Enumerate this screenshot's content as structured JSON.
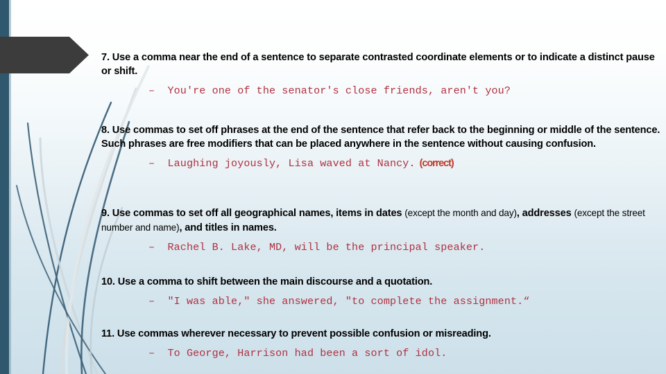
{
  "slide": {
    "background_top_color": "#ffffff",
    "background_bottom_color": "#cde0ea",
    "accent_bar_color": "#2f576e",
    "banner_color": "#3c3c3c",
    "example_text_color": "#b03040",
    "annotation_color": "#c0392b"
  },
  "rules": [
    {
      "id": "rule-7",
      "text": "7. Use a comma near the end of a sentence to separate contrasted coordinate elements or to indicate a distinct pause or shift.",
      "example": "–  You're one of the senator's close friends, aren't you?",
      "annotation": ""
    },
    {
      "id": "rule-8",
      "text": "8. Use commas to set off phrases at the end of the sentence that refer back to the beginning or middle of the sentence. Such phrases are free modifiers that can be placed anywhere in the sentence without causing confusion.",
      "example": "–  Laughing joyously, Lisa waved at Nancy.",
      "annotation": "(correct)"
    },
    {
      "id": "rule-9",
      "text_part1": "9. Use commas to set off all geographical names, items in dates ",
      "text_paren1": "(except the month and day)",
      "text_part2": ", addresses ",
      "text_paren2": "(except the street number and name)",
      "text_part3": ", and titles in names.",
      "example": "–  Rachel B. Lake, MD, will be the principal speaker.",
      "annotation": ""
    },
    {
      "id": "rule-10",
      "text": "10. Use a comma to shift between the main discourse and a quotation.",
      "example": "–  \"I was able,\" she answered, \"to complete the assignment.“",
      "annotation": ""
    },
    {
      "id": "rule-11",
      "text": "11. Use commas wherever necessary to prevent possible confusion or misreading.",
      "example": "–  To George, Harrison had been a sort of idol.",
      "annotation": ""
    }
  ]
}
